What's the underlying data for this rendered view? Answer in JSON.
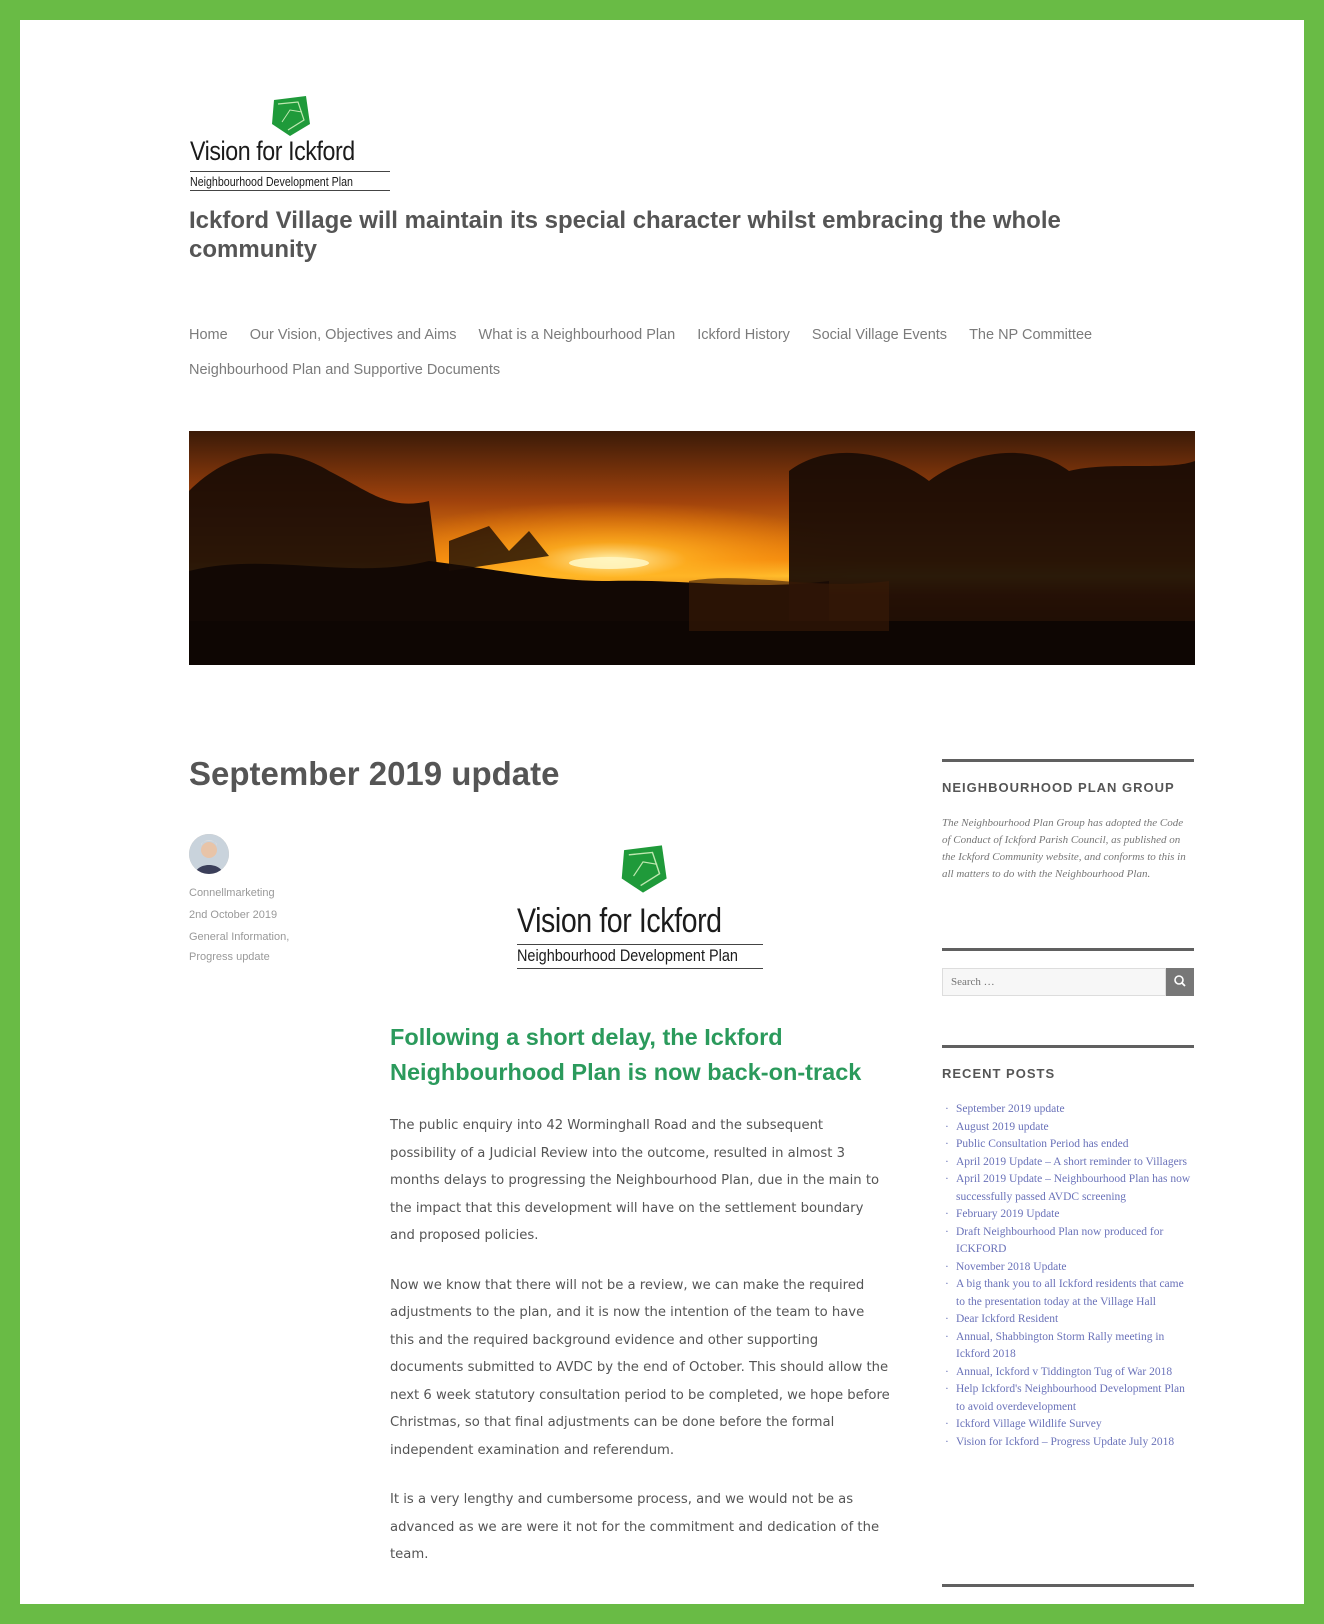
{
  "site": {
    "logo_title": "Vision for Ickford",
    "logo_subtitle": "Neighbourhood Development Plan",
    "tagline": "Ickford Village will maintain its special character whilst embracing the whole community"
  },
  "nav": {
    "items": [
      "Home",
      "Our Vision, Objectives and Aims",
      "What is a Neighbourhood Plan",
      "Ickford History",
      "Social Village Events",
      "The NP Committee",
      "Neighbourhood Plan and Supportive Documents"
    ]
  },
  "post": {
    "title": "September 2019 update",
    "author": "Connellmarketing",
    "date": "2nd October 2019",
    "categories": "General Information,",
    "categories2": "Progress update",
    "logo_title": "Vision for Ickford",
    "logo_subtitle": "Neighbourhood Development Plan",
    "subheading": "Following a short delay, the Ickford Neighbourhood Plan is now back-on-track",
    "paragraphs": [
      "The public enquiry into 42 Worminghall Road and the subsequent possibility of a Judicial Review into the outcome, resulted in almost 3 months delays to progressing the Neighbourhood Plan, due in the main to the impact that this development will have on the settlement boundary and proposed policies.",
      "Now we know that there will not be a review, we can make the required adjustments to the plan, and it is now the intention of the team to have this and the required background evidence and other supporting documents submitted to AVDC by the end of October. This should allow the next 6 week statutory consultation period to be completed, we hope before Christmas, so that final adjustments can be done before the formal independent examination and referendum.",
      "It is a very lengthy and cumbersome process, and we would not be as advanced as we are were it not for the commitment and dedication of the team."
    ]
  },
  "sidebar": {
    "group_heading": "NEIGHBOURHOOD PLAN GROUP",
    "group_text": "The Neighbourhood Plan Group has adopted the Code of Conduct of Ickford Parish Council, as published on the Ickford Community website, and conforms to this in all matters to do with the Neighbourhood Plan.",
    "search_placeholder": "Search …",
    "recent_heading": "RECENT POSTS",
    "recent_posts": [
      "September 2019 update",
      "August 2019 update",
      "Public Consultation Period has ended",
      "April 2019 Update – A short reminder to Villagers",
      "April 2019 Update – Neighbourhood Plan has now successfully passed AVDC screening",
      "February 2019 Update",
      "Draft Neighbourhood Plan now produced for ICKFORD",
      "November 2018 Update",
      "A big thank you to all Ickford residents that came to the presentation today at the Village Hall",
      "Dear Ickford Resident",
      "Annual, Shabbington Storm Rally meeting in Ickford 2018",
      "Annual, Ickford v Tiddington Tug of War 2018",
      "Help Ickford's Neighbourhood Development Plan to avoid overdevelopment",
      "Ickford Village Wildlife Survey",
      "Vision for Ickford – Progress Update July 2018"
    ]
  },
  "colors": {
    "frame": "#69bb45",
    "subheading": "#2b9a5c",
    "link": "#6a72b9"
  }
}
